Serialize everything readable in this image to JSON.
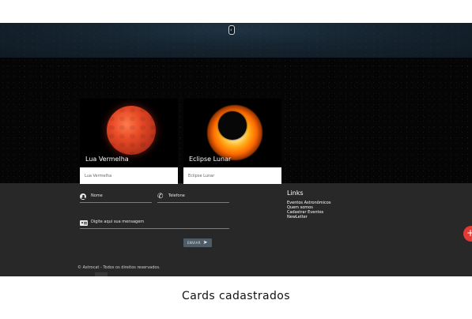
{
  "header": {
    "collapse_icon_glyph": "‹"
  },
  "cards": [
    {
      "title": "Lua Vermelha",
      "description": "Lua Vermelha"
    },
    {
      "title": "Eclipse Lunar",
      "description": "Eclipse Lunar"
    }
  ],
  "contact_form": {
    "name_label": "Nome",
    "phone_label": "Telefone",
    "message_label": "Digite aqui sua mensagem",
    "send_label": "ENVIAR",
    "send_icon_glyph": "➤"
  },
  "links": {
    "title": "Links",
    "items": [
      "Eventos Astronômicos",
      "Quem somos",
      "Cadastrar Eventos",
      "NewLetter"
    ]
  },
  "footer": {
    "copyright": "© Astrocat - Todos os direitos reservados."
  },
  "fab": {
    "glyph": "+"
  },
  "caption": "Cards cadastrados",
  "colors": {
    "accent": "#e53935",
    "footer_bg": "#282828"
  }
}
